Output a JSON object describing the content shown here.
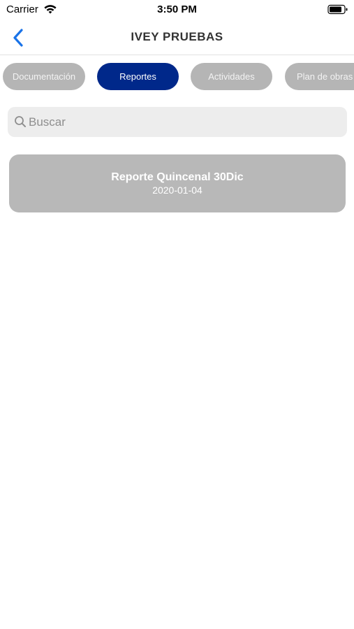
{
  "status_bar": {
    "carrier": "Carrier",
    "time": "3:50 PM",
    "wifi_icon": "wifi-icon",
    "battery_icon": "battery-icon"
  },
  "nav": {
    "back_icon": "chevron-left-icon",
    "title": "IVEY PRUEBAS",
    "accent_color": "#1a73e8"
  },
  "tabs": [
    {
      "label": "Documentación",
      "active": false
    },
    {
      "label": "Reportes",
      "active": true
    },
    {
      "label": "Actividades",
      "active": false
    },
    {
      "label": "Plan de obras",
      "active": false
    }
  ],
  "colors": {
    "active_tab": "#00288a",
    "inactive_tab": "#b5b5b5",
    "card": "#b8b8b8"
  },
  "search": {
    "icon": "search-icon",
    "placeholder": "Buscar",
    "value": ""
  },
  "reports": [
    {
      "title": "Reporte Quincenal 30Dic",
      "date": "2020-01-04"
    }
  ]
}
